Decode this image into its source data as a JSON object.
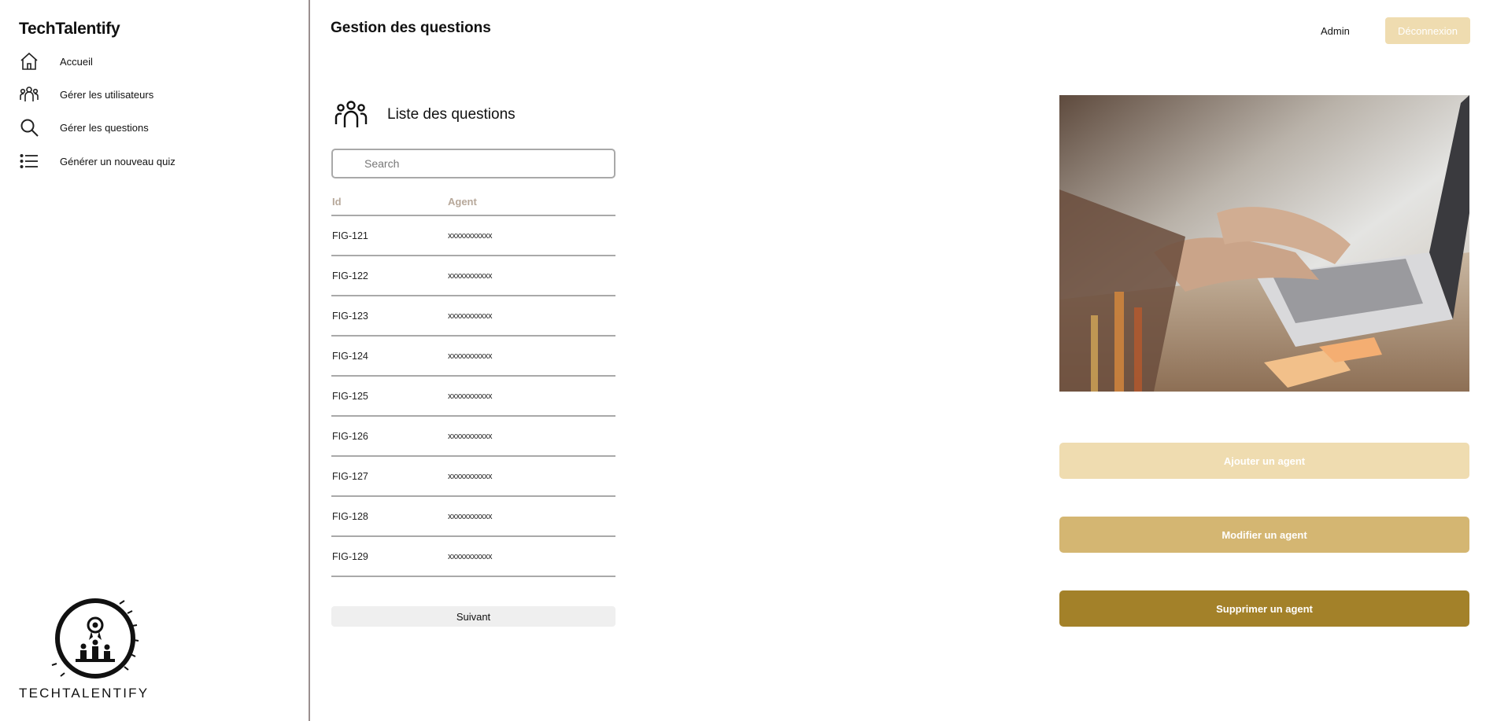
{
  "brand": "TechTalentify",
  "sidebar": {
    "items": [
      {
        "label": "Accueil",
        "icon": "home-icon"
      },
      {
        "label": "Gérer les utilisateurs",
        "icon": "users-icon"
      },
      {
        "label": "Gérer les questions",
        "icon": "search-icon"
      },
      {
        "label": "Générer un nouveau quiz",
        "icon": "list-icon"
      }
    ],
    "logo_text": "TECHTALENTIFY"
  },
  "header": {
    "title": "Gestion des questions",
    "user": "Admin",
    "logout_label": "Déconnexion"
  },
  "list": {
    "title": "Liste des questions",
    "search_placeholder": "Search",
    "columns": [
      "Id",
      "Agent"
    ],
    "rows": [
      {
        "id": "FIG-121",
        "agent": "xxxxxxxxxxx"
      },
      {
        "id": "FIG-122",
        "agent": "xxxxxxxxxxx"
      },
      {
        "id": "FIG-123",
        "agent": "xxxxxxxxxxx"
      },
      {
        "id": "FIG-124",
        "agent": "xxxxxxxxxxx"
      },
      {
        "id": "FIG-125",
        "agent": "xxxxxxxxxxx"
      },
      {
        "id": "FIG-126",
        "agent": "xxxxxxxxxxx"
      },
      {
        "id": "FIG-127",
        "agent": "xxxxxxxxxxx"
      },
      {
        "id": "FIG-128",
        "agent": "xxxxxxxxxxx"
      },
      {
        "id": "FIG-129",
        "agent": "xxxxxxxxxxx"
      }
    ],
    "next_label": "Suivant"
  },
  "actions": {
    "add_label": "Ajouter un agent",
    "edit_label": "Modifier un agent",
    "delete_label": "Supprimer un agent"
  },
  "colors": {
    "accent_light": "#efdcb0",
    "accent_mid": "#d4b672",
    "accent_dark": "#a38129"
  }
}
